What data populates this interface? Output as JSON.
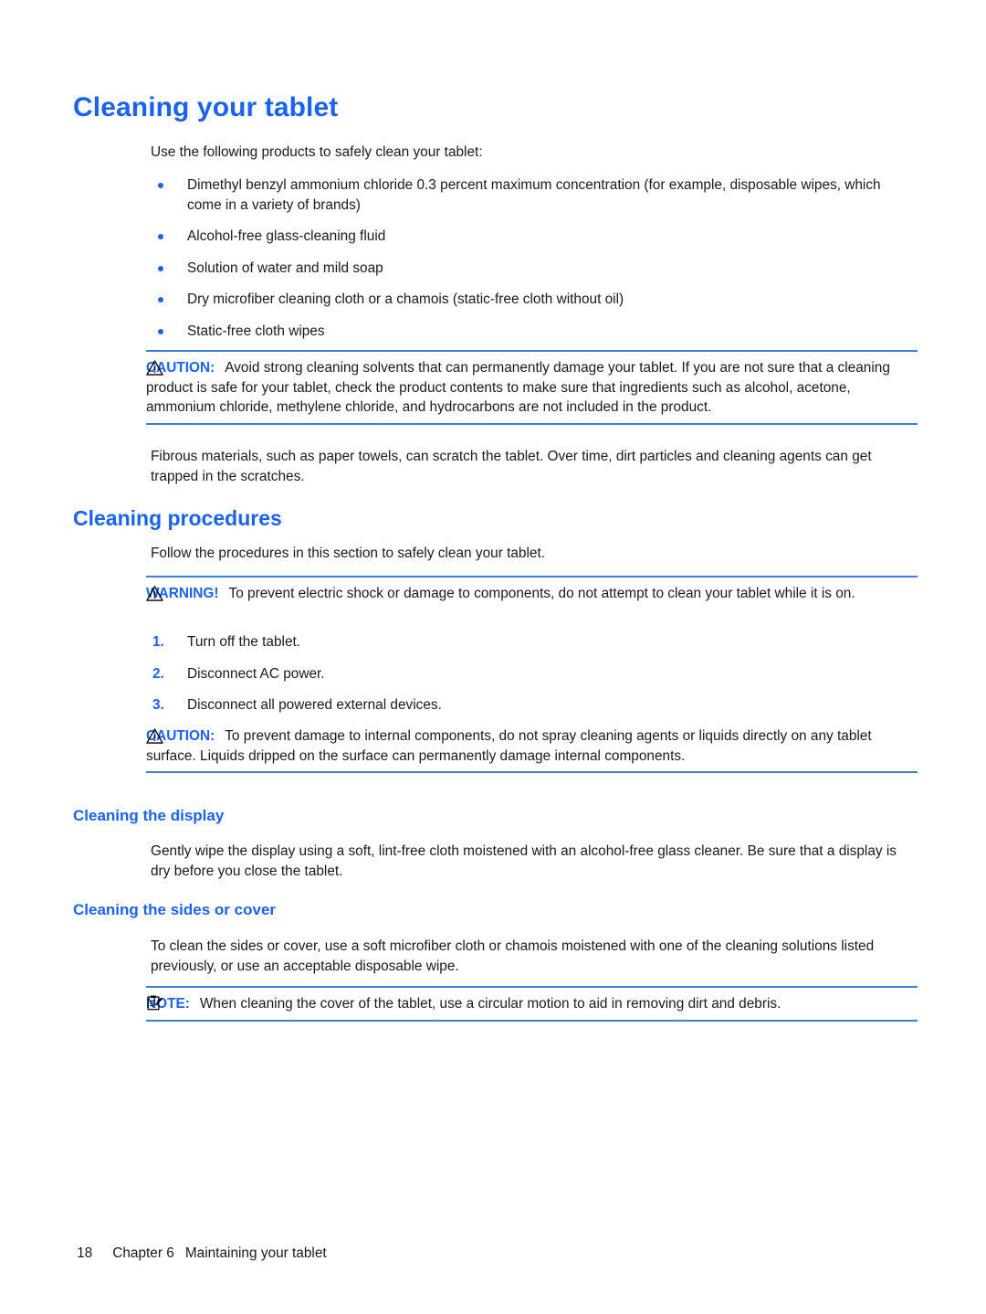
{
  "document": {
    "colors": {
      "heading_blue": "#1a63f0",
      "rule_blue": "#3b7ddd",
      "body_black": "#1a1a1a"
    },
    "title": "Cleaning your tablet",
    "intro": "Use the following products to safely clean your tablet:",
    "product_bullets": [
      "Dimethyl benzyl ammonium chloride 0.3 percent maximum concentration (for example, disposable wipes, which come in a variety of brands)",
      "Alcohol-free glass-cleaning fluid",
      "Solution of water and mild soap",
      "Dry microfiber cleaning cloth or a chamois (static-free cloth without oil)",
      "Static-free cloth wipes"
    ],
    "caution_1": {
      "icon": "warning-triangle-icon",
      "label": "CAUTION:",
      "text": "Avoid strong cleaning solvents that can permanently damage your tablet. If you are not sure that a cleaning product is safe for your tablet, check the product contents to make sure that ingredients such as alcohol, acetone, ammonium chloride, methylene chloride, and hydrocarbons are not included in the product."
    },
    "fibrous_paragraph": "Fibrous materials, such as paper towels, can scratch the tablet. Over time, dirt particles and cleaning agents can get trapped in the scratches.",
    "section_procedures": {
      "heading": "Cleaning procedures",
      "intro": "Follow the procedures in this section to safely clean your tablet.",
      "warning": {
        "icon": "warning-triangle-icon",
        "label": "WARNING!",
        "text": "To prevent electric shock or damage to components, do not attempt to clean your tablet while it is on."
      },
      "steps": [
        {
          "number": "1.",
          "text": "Turn off the tablet."
        },
        {
          "number": "2.",
          "text": "Disconnect AC power."
        },
        {
          "number": "3.",
          "text": "Disconnect all powered external devices."
        }
      ],
      "caution": {
        "icon": "warning-triangle-icon",
        "label": "CAUTION:",
        "text": "To prevent damage to internal components, do not spray cleaning agents or liquids directly on any tablet surface. Liquids dripped on the surface can permanently damage internal components."
      }
    },
    "section_display": {
      "heading": "Cleaning the display",
      "text": "Gently wipe the display using a soft, lint-free cloth moistened with an alcohol-free glass cleaner. Be sure that a display is dry before you close the tablet."
    },
    "section_sides": {
      "heading": "Cleaning the sides or cover",
      "text": "To clean the sides or cover, use a soft microfiber cloth or chamois moistened with one of the cleaning solutions listed previously, or use an acceptable disposable wipe.",
      "note": {
        "icon": "note-clipboard-icon",
        "label": "NOTE:",
        "text": "When cleaning the cover of the tablet, use a circular motion to aid in removing dirt and debris."
      }
    },
    "footer": {
      "page_number": "18",
      "chapter": "Chapter 6",
      "chapter_title": "Maintaining your tablet"
    }
  }
}
